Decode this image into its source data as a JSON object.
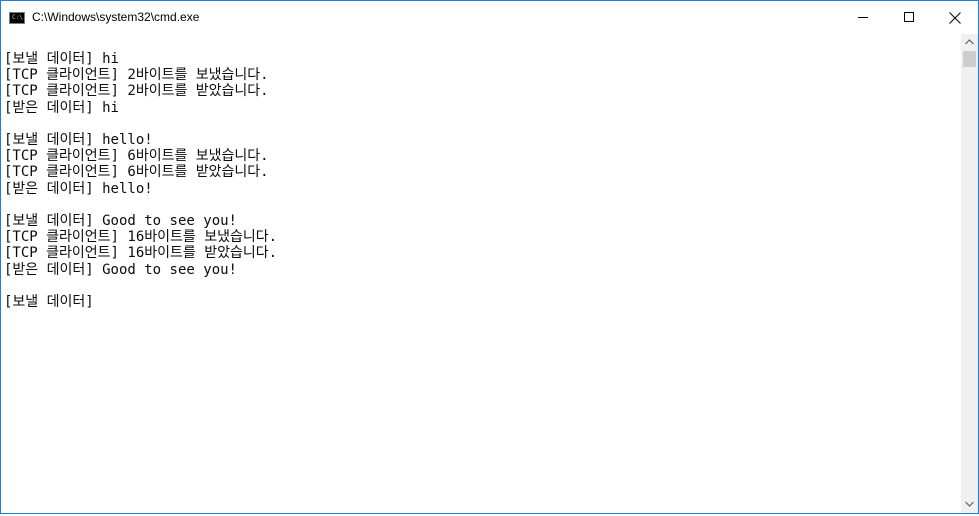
{
  "window": {
    "title": "C:\\Windows\\system32\\cmd.exe",
    "icon": "cmd-icon",
    "icon_prompt": "C:\\.",
    "controls": {
      "minimize": "minimize-icon",
      "maximize": "maximize-icon",
      "close": "close-icon"
    }
  },
  "console": {
    "lines": [
      "[보낼 데이터] hi",
      "[TCP 클라이언트] 2바이트를 보냈습니다.",
      "[TCP 클라이언트] 2바이트를 받았습니다.",
      "[받은 데이터] hi",
      "",
      "[보낼 데이터] hello!",
      "[TCP 클라이언트] 6바이트를 보냈습니다.",
      "[TCP 클라이언트] 6바이트를 받았습니다.",
      "[받은 데이터] hello!",
      "",
      "[보낼 데이터] Good to see you!",
      "[TCP 클라이언트] 16바이트를 보냈습니다.",
      "[TCP 클라이언트] 16바이트를 받았습니다.",
      "[받은 데이터] Good to see you!",
      "",
      "[보낼 데이터]"
    ]
  },
  "colors": {
    "border": "#1c7fcf",
    "background": "#ffffff",
    "text": "#0c0c0c",
    "scrollbar": "#f0f0f0",
    "thumb": "#cdcdcd"
  }
}
